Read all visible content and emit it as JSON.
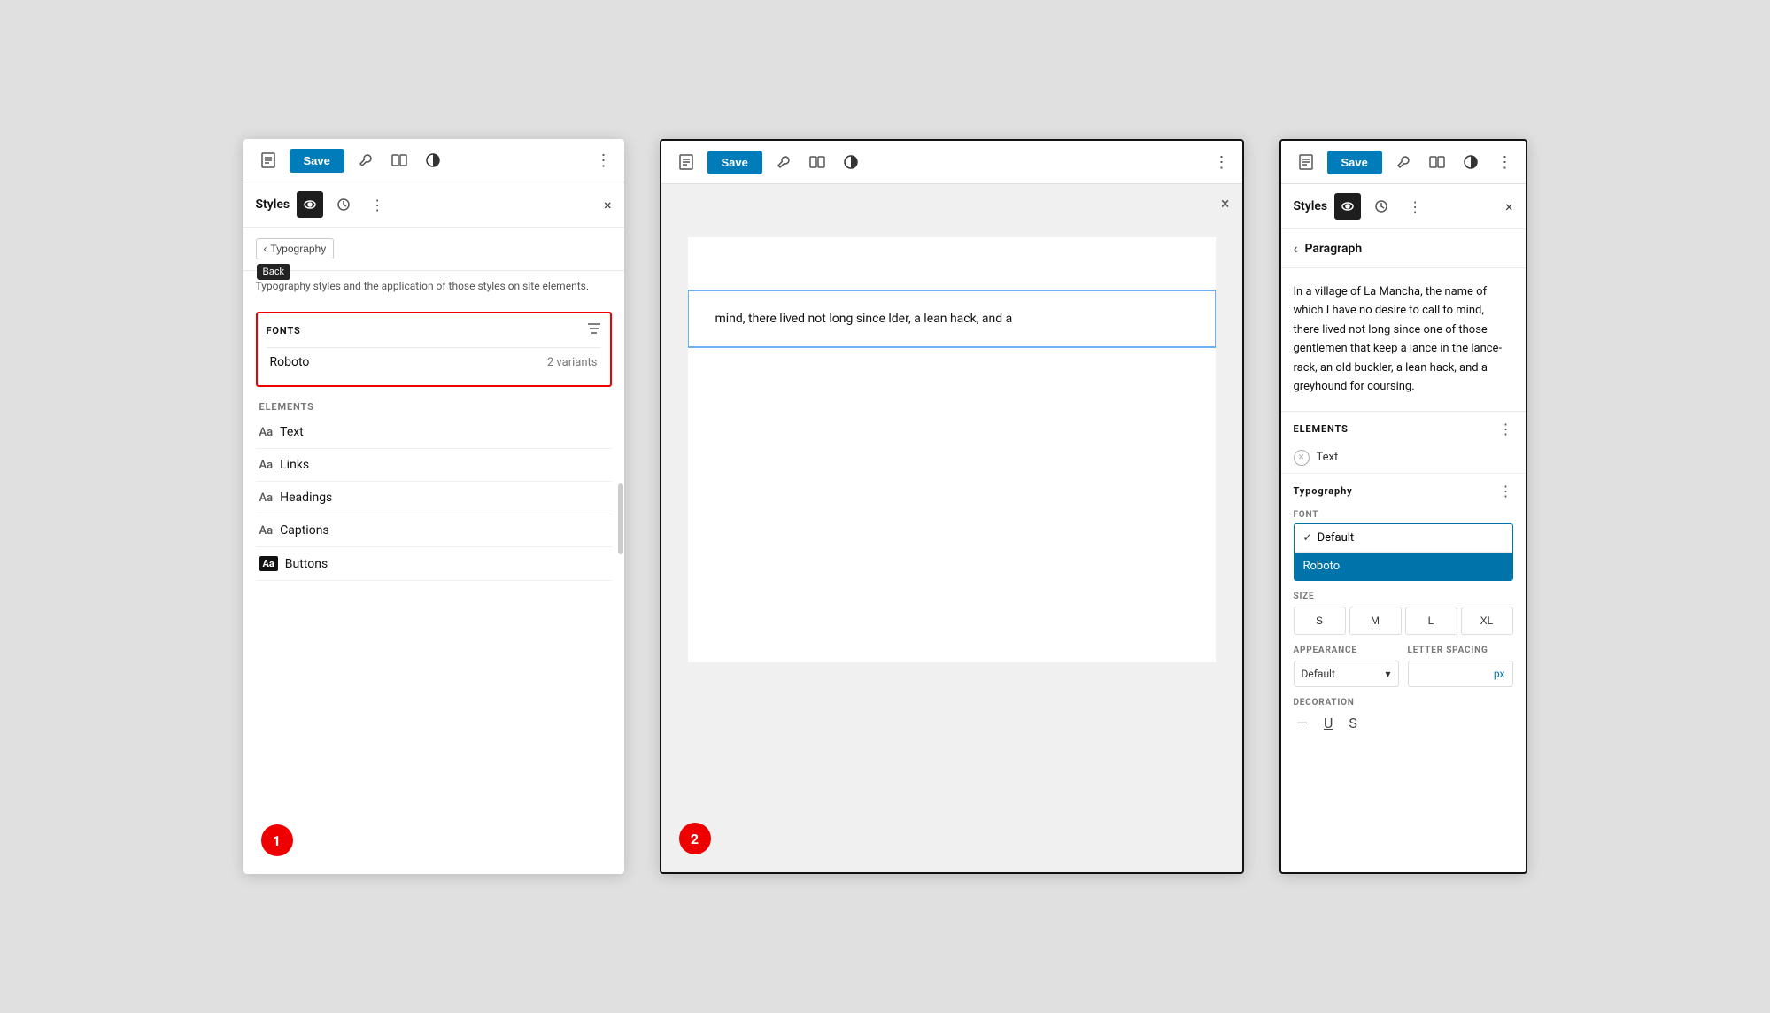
{
  "panel1": {
    "toolbar": {
      "save_label": "Save",
      "icons": [
        "page-icon",
        "wrench-icon",
        "columns-icon",
        "contrast-icon",
        "more-icon"
      ]
    },
    "styles_panel": {
      "title": "Styles",
      "back_tooltip": "Back",
      "typography_label": "Typography",
      "description": "Typography styles and the application of those styles on site elements.",
      "fonts_section": {
        "label": "FONTS",
        "font_name": "Roboto",
        "font_variants": "2 variants"
      },
      "elements_section": {
        "label": "ELEMENTS",
        "items": [
          {
            "name": "Text",
            "prefix": "Aa"
          },
          {
            "name": "Links",
            "prefix": "Aa"
          },
          {
            "name": "Headings",
            "prefix": "Aa"
          },
          {
            "name": "Captions",
            "prefix": "Aa"
          },
          {
            "name": "Buttons",
            "prefix": "Aa"
          }
        ]
      }
    },
    "step_number": "1",
    "close_label": "×"
  },
  "panel2": {
    "toolbar": {
      "save_label": "Save"
    },
    "canvas_text": "mind, there lived not long since lder, a lean hack, and a",
    "step_number": "2"
  },
  "panel3": {
    "toolbar": {
      "save_label": "Save"
    },
    "styles_title": "Styles",
    "paragraph_label": "Paragraph",
    "preview_text": "In a village of La Mancha, the name of which I have no desire to call to mind, there lived not long since one of those gentlemen that keep a lance in the lance-rack, an old buckler, a lean hack, and a greyhound for coursing.",
    "elements_label": "ELEMENTS",
    "element_name": "Text",
    "typography_label": "Typography",
    "font_section": {
      "label": "FONT",
      "options": [
        {
          "name": "Default",
          "selected": false,
          "checked": true
        },
        {
          "name": "Roboto",
          "selected": true,
          "checked": false
        }
      ]
    },
    "size_section": {
      "label": "SIZE",
      "options": [
        "S",
        "M",
        "L",
        "XL"
      ]
    },
    "appearance_section": {
      "label": "APPEARANCE",
      "value": "Default"
    },
    "letter_spacing_section": {
      "label": "LETTER SPACING",
      "unit": "px",
      "value": ""
    },
    "decoration_section": {
      "label": "DECORATION",
      "buttons": [
        "—",
        "U",
        "S"
      ]
    }
  }
}
